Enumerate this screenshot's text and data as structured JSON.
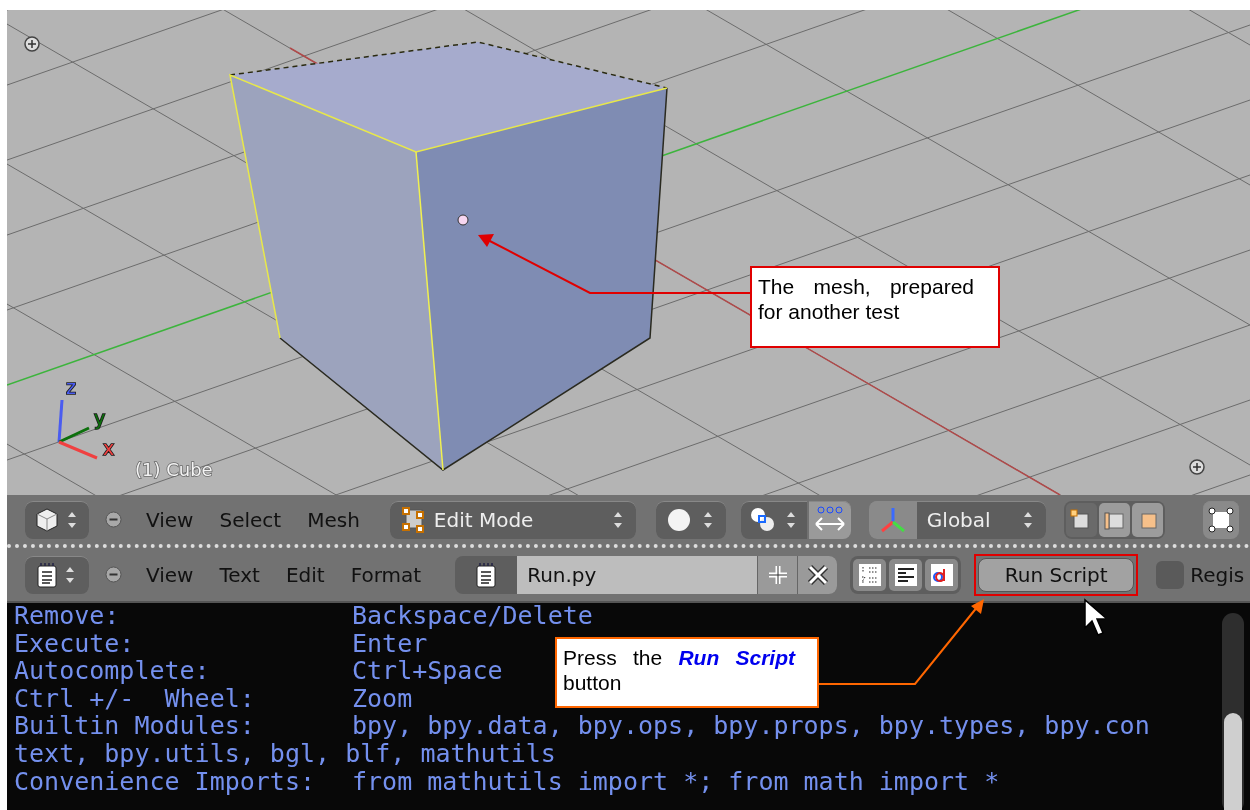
{
  "viewport": {
    "object_label": "(1) Cube",
    "axis_labels": [
      {
        "text": "z",
        "color": "#4a5cf0"
      },
      {
        "text": "y",
        "color": "#0c700c"
      },
      {
        "text": "x",
        "color": "#f04040"
      }
    ]
  },
  "viewport_header": {
    "menus": [
      "View",
      "Select",
      "Mesh"
    ],
    "mode": "Edit Mode",
    "orientation": "Global",
    "select_modes": [
      {
        "selected": true
      },
      {
        "selected": false
      },
      {
        "selected": false
      }
    ]
  },
  "text_editor_header": {
    "menus": [
      "View",
      "Text",
      "Edit",
      "Format"
    ],
    "text_name": "Run.py",
    "run_button": "Run Script",
    "checkbox": {
      "label": "Regis",
      "checked": false
    }
  },
  "text_editor": {
    "lines": [
      {
        "key": "Remove:",
        "value": "Backspace/Delete"
      },
      {
        "key": "Execute:",
        "value": "Enter"
      },
      {
        "key": "Autocomplete:",
        "value": "Ctrl+Space"
      },
      {
        "key": "Ctrl +/-  Wheel:",
        "value": "Zoom"
      },
      {
        "key": "Builtin Modules:",
        "value": "bpy, bpy.data, bpy.ops, bpy.props, bpy.types, bpy.con"
      },
      {
        "text": "text, bpy.utils, bgl, blf, mathutils"
      },
      {
        "key": "Convenience Imports:",
        "value": "from mathutils import *; from math import *"
      }
    ]
  },
  "callouts": [
    {
      "before": "The mesh, prepared for another test",
      "color": "#e00000"
    },
    {
      "before": "Press the",
      "emphasis": "Run Script",
      "after": "button",
      "color": "#ff6600"
    }
  ]
}
